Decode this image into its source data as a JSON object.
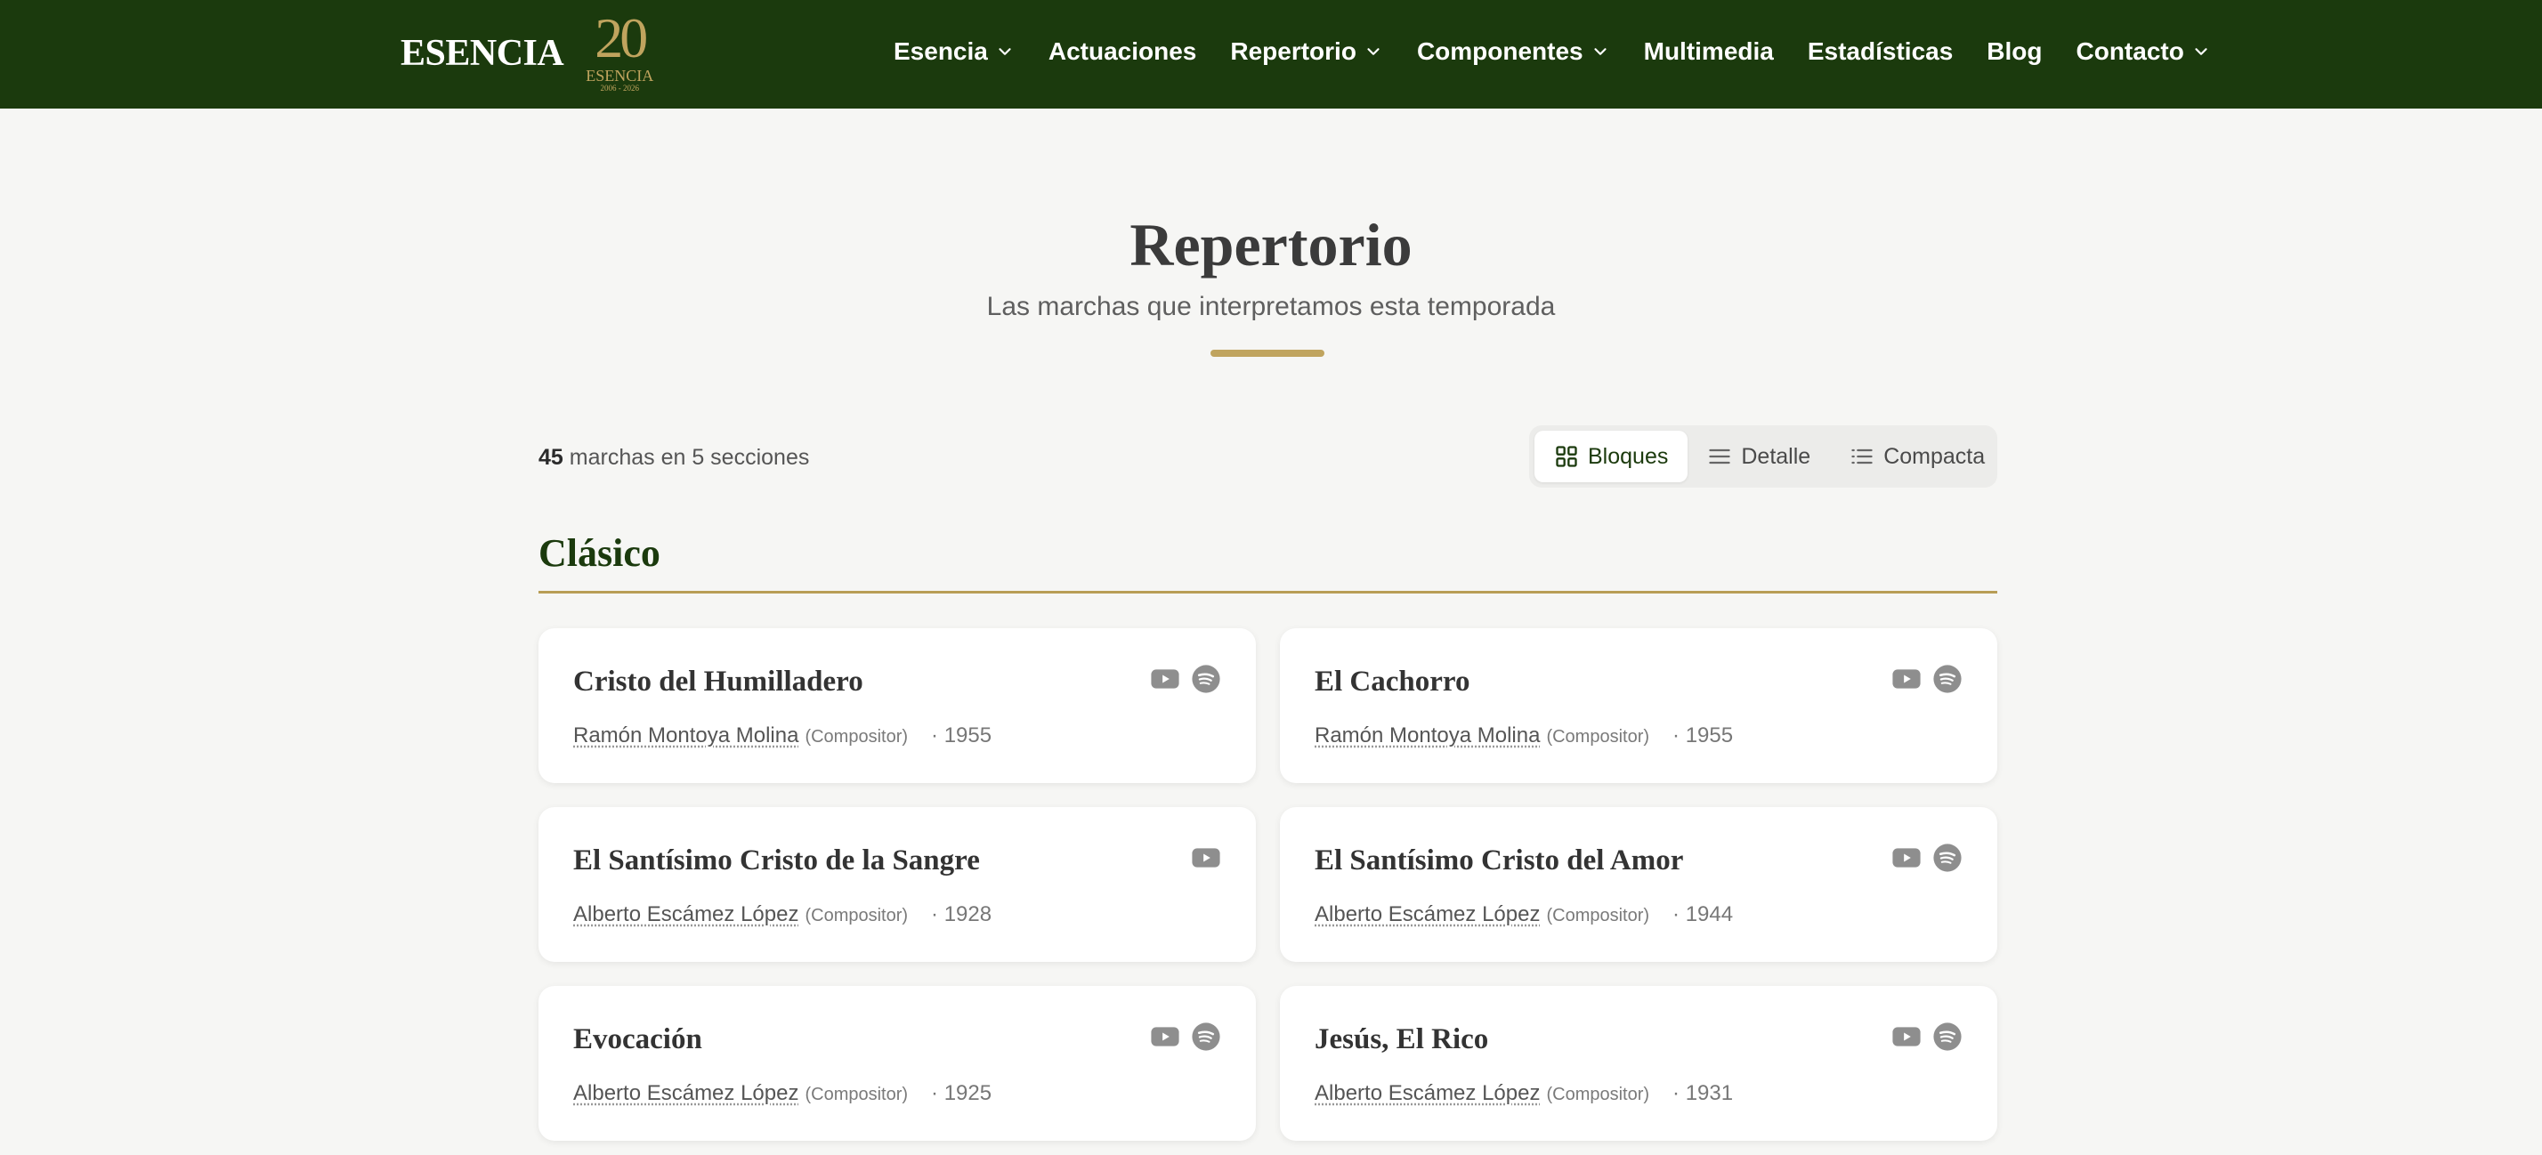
{
  "brand": {
    "name": "ESENCIA",
    "badge_number": "20",
    "badge_name": "ESENCIA",
    "badge_years": "2006 - 2026"
  },
  "nav": {
    "items": [
      {
        "label": "Esencia",
        "has_dropdown": true
      },
      {
        "label": "Actuaciones",
        "has_dropdown": false
      },
      {
        "label": "Repertorio",
        "has_dropdown": true
      },
      {
        "label": "Componentes",
        "has_dropdown": true
      },
      {
        "label": "Multimedia",
        "has_dropdown": false
      },
      {
        "label": "Estadísticas",
        "has_dropdown": false
      },
      {
        "label": "Blog",
        "has_dropdown": false
      },
      {
        "label": "Contacto",
        "has_dropdown": true
      }
    ]
  },
  "page": {
    "title": "Repertorio",
    "subtitle": "Las marchas que interpretamos esta temporada"
  },
  "summary": {
    "count": "45",
    "text": "marchas en 5 secciones"
  },
  "views": [
    {
      "label": "Bloques",
      "icon": "grid-icon",
      "active": true
    },
    {
      "label": "Detalle",
      "icon": "lines-icon",
      "active": false
    },
    {
      "label": "Compacta",
      "icon": "list-icon",
      "active": false
    }
  ],
  "section": {
    "title": "Clásico"
  },
  "cards": [
    {
      "title": "Cristo del Humilladero",
      "composer": "Ramón Montoya Molina",
      "role": "(Compositor)",
      "year": "· 1955",
      "youtube": true,
      "spotify": true
    },
    {
      "title": "El Cachorro",
      "composer": "Ramón Montoya Molina",
      "role": "(Compositor)",
      "year": "· 1955",
      "youtube": true,
      "spotify": true
    },
    {
      "title": "El Santísimo Cristo de la Sangre",
      "composer": "Alberto Escámez López",
      "role": "(Compositor)",
      "year": "· 1928",
      "youtube": true,
      "spotify": false
    },
    {
      "title": "El Santísimo Cristo del Amor",
      "composer": "Alberto Escámez López",
      "role": "(Compositor)",
      "year": "· 1944",
      "youtube": true,
      "spotify": true
    },
    {
      "title": "Evocación",
      "composer": "Alberto Escámez López",
      "role": "(Compositor)",
      "year": "· 1925",
      "youtube": true,
      "spotify": true
    },
    {
      "title": "Jesús, El Rico",
      "composer": "Alberto Escámez López",
      "role": "(Compositor)",
      "year": "· 1931",
      "youtube": true,
      "spotify": true
    }
  ],
  "colors": {
    "header_bg": "#1b3a0d",
    "accent_gold": "#c0a45e",
    "page_bg": "#f6f6f4",
    "icon_gray": "#8e8e8e"
  }
}
